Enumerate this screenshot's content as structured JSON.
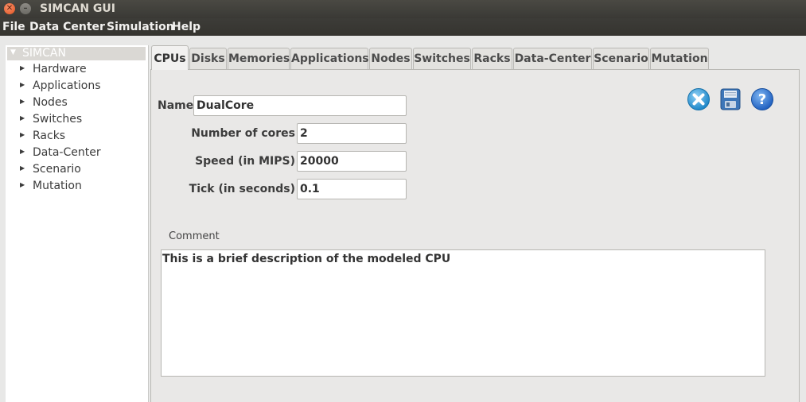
{
  "window": {
    "title": "SIMCAN GUI"
  },
  "menu": [
    "File",
    "Data Center",
    "Simulation",
    "Help"
  ],
  "tree": {
    "root": "SIMCAN",
    "items": [
      "Hardware",
      "Applications",
      "Nodes",
      "Switches",
      "Racks",
      "Data-Center",
      "Scenario",
      "Mutation"
    ]
  },
  "tabs": [
    "CPUs",
    "Disks",
    "Memories",
    "Applications",
    "Nodes",
    "Switches",
    "Racks",
    "Data-Center",
    "Scenario",
    "Mutation"
  ],
  "active_tab": "CPUs",
  "form": {
    "name_label": "Name",
    "name_value": "DualCore",
    "cores_label": "Number of cores",
    "cores_value": "2",
    "speed_label": "Speed (in MIPS)",
    "speed_value": "20000",
    "tick_label": "Tick (in seconds)",
    "tick_value": "0.1",
    "comment_label": "Comment",
    "comment_value": "This is a brief description of the modeled CPU"
  },
  "toolbar": {
    "icons": [
      "delete-icon",
      "save-icon",
      "help-icon"
    ]
  },
  "colors": {
    "accent_blue": "#2e7fd6",
    "close_red": "#e2521f"
  }
}
